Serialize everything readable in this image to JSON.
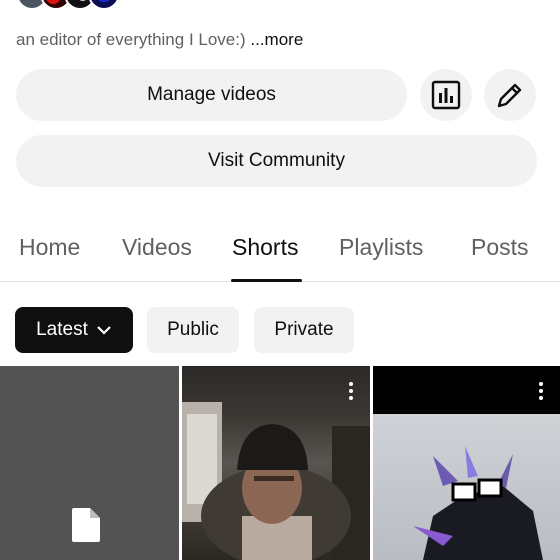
{
  "bio": {
    "text": "an editor of everything I Love:)",
    "more": "...more"
  },
  "actions": {
    "manage_videos": "Manage videos",
    "visit_community": "Visit Community",
    "analytics_icon": "analytics-icon",
    "edit_icon": "pencil-icon"
  },
  "tabs": [
    "Home",
    "Videos",
    "Shorts",
    "Playlists",
    "Posts"
  ],
  "active_tab": "Shorts",
  "filters": {
    "latest": "Latest",
    "public": "Public",
    "private": "Private"
  },
  "shorts": [
    {
      "icon": "file-icon"
    },
    {
      "icon": "more-vert-icon"
    },
    {
      "icon": "more-vert-icon"
    }
  ],
  "colors": {
    "text_primary": "#0f0f0f",
    "text_secondary": "#606060",
    "chip_bg": "#f2f2f2",
    "chip_active_bg": "#0f0f0f"
  }
}
